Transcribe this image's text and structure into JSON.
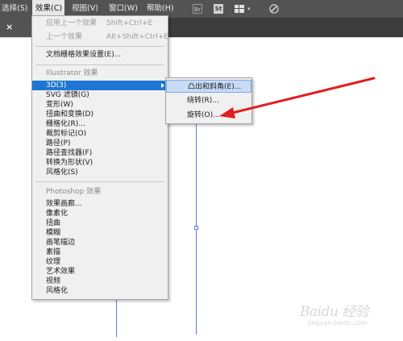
{
  "menubar": {
    "items": [
      "选择(S)",
      "效果(C)",
      "视图(V)",
      "窗口(W)",
      "帮助(H)"
    ],
    "active_index": 1
  },
  "toolbar_icons": [
    "bridge-icon",
    "stock-icon",
    "workspace-grid-icon",
    "chevron-down-icon",
    "gpu-brush-icon"
  ],
  "toolbar_text": {
    "br": "Br",
    "st": "St"
  },
  "tab": {
    "close_glyph": "×"
  },
  "effects_menu": {
    "apply_last": {
      "label": "应用上一个效果",
      "shortcut": "Shift+Ctrl+E"
    },
    "last_effect": {
      "label": "上一个效果",
      "shortcut": "Alt+Shift+Ctrl+E"
    },
    "raster_settings": "文档栅格效果设置(E)...",
    "illustrator_header": "Illustrator 效果",
    "illustrator_items": [
      "3D(3)",
      "SVG 滤镜(G)",
      "变形(W)",
      "扭曲和变换(D)",
      "栅格化(R)...",
      "裁剪标记(O)",
      "路径(P)",
      "路径查找器(F)",
      "转换为形状(V)",
      "风格化(S)"
    ],
    "selected_item": "3D(3)",
    "photoshop_header": "Photoshop 效果",
    "photoshop_items": [
      "效果画廊...",
      "像素化",
      "扭曲",
      "模糊",
      "画笔描边",
      "素描",
      "纹理",
      "艺术效果",
      "视频",
      "风格化"
    ]
  },
  "submenu_3d": {
    "items": [
      "凸出和斜角(E)...",
      "绕转(R)...",
      "旋转(O)..."
    ],
    "highlighted_item": "凸出和斜角(E)..."
  },
  "watermark": {
    "text": "Baidu 经验",
    "sub": "jingyan.baidu.com"
  },
  "colors": {
    "menubar_bg": "#535353",
    "selection_blue": "#1e76d2",
    "path_blue": "#5a7fd6",
    "annotation_red": "#e02020"
  }
}
